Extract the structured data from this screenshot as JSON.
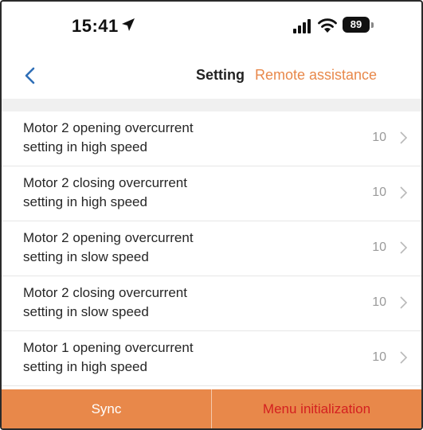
{
  "status_bar": {
    "time": "15:41",
    "battery": "89",
    "icons": [
      "location-arrow-icon",
      "signal-bars-icon",
      "wifi-icon",
      "battery-icon"
    ]
  },
  "nav": {
    "title": "Setting",
    "action": "Remote assistance",
    "back_icon": "chevron-left-icon"
  },
  "colors": {
    "accent": "#e8884a",
    "back_arrow": "#2f6fb7",
    "danger_text": "#d42020",
    "value_text": "#9a9a9a"
  },
  "settings": [
    {
      "label": "Motor 2 opening overcurrent\nsetting in high speed",
      "value": "10"
    },
    {
      "label": "Motor 2 closing overcurrent\nsetting in high speed",
      "value": "10"
    },
    {
      "label": "Motor 2 opening overcurrent\nsetting in slow speed",
      "value": "10"
    },
    {
      "label": "Motor 2 closing overcurrent\nsetting in slow speed",
      "value": "10"
    },
    {
      "label": "Motor 1 opening overcurrent\nsetting in high speed",
      "value": "10"
    }
  ],
  "bottom_bar": {
    "sync": "Sync",
    "menu_init": "Menu initialization"
  }
}
